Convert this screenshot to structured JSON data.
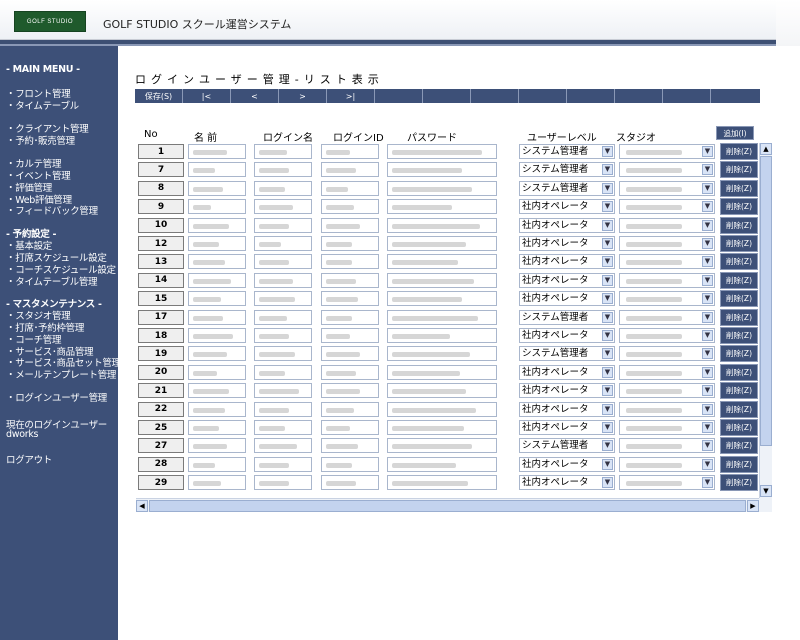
{
  "header": {
    "logo_text": "GOLF STUDIO",
    "title": "GOLF STUDIO スクール運営システム"
  },
  "sidebar": {
    "main_menu": "- MAIN MENU -",
    "items": [
      {
        "label": "・フロント管理"
      },
      {
        "label": "・タイムテーブル"
      },
      {
        "label": "・クライアント管理"
      },
      {
        "label": "・予約･販売管理"
      },
      {
        "label": "・カルテ管理"
      },
      {
        "label": "・イベント管理"
      },
      {
        "label": "・評価管理"
      },
      {
        "label": "・Web評価管理"
      },
      {
        "label": "・フィードバック管理"
      },
      {
        "label": "- 予約設定 -"
      },
      {
        "label": "・基本設定"
      },
      {
        "label": "・打席スケジュール設定"
      },
      {
        "label": "・コーチスケジュール設定"
      },
      {
        "label": "・タイムテーブル管理"
      },
      {
        "label": "- マスタメンテナンス -"
      },
      {
        "label": "・スタジオ管理"
      },
      {
        "label": "・打席･予約枠管理"
      },
      {
        "label": "・コーチ管理"
      },
      {
        "label": "・サービス･商品管理"
      },
      {
        "label": "・サービス･商品セット管理"
      },
      {
        "label": "・メールテンプレート管理"
      },
      {
        "label": "・ログインユーザー管理"
      }
    ],
    "current_user_label": "現在のログインユーザー",
    "current_user": "dworks",
    "logout": "ログアウト"
  },
  "main": {
    "page_title": "ログインユーザー管理-リスト表示",
    "toolbar": {
      "save": "保存(S)",
      "first": "|<",
      "prev": "<",
      "next": ">",
      "last": ">|"
    },
    "columns": {
      "no": "No",
      "name": "名 前",
      "login_name": "ログイン名",
      "login_id": "ログインID",
      "password": "パスワード",
      "user_level": "ユーザーレベル",
      "studio": "スタジオ"
    },
    "add_button": "追加(I)",
    "delete_label": "削除(Z)",
    "rows": [
      {
        "no": "1",
        "level": "システム管理者"
      },
      {
        "no": "7",
        "level": "システム管理者"
      },
      {
        "no": "8",
        "level": "システム管理者"
      },
      {
        "no": "9",
        "level": "社内オペレータ"
      },
      {
        "no": "10",
        "level": "社内オペレータ"
      },
      {
        "no": "12",
        "level": "社内オペレータ"
      },
      {
        "no": "13",
        "level": "社内オペレータ"
      },
      {
        "no": "14",
        "level": "社内オペレータ"
      },
      {
        "no": "15",
        "level": "社内オペレータ"
      },
      {
        "no": "17",
        "level": "システム管理者"
      },
      {
        "no": "18",
        "level": "社内オペレータ"
      },
      {
        "no": "19",
        "level": "システム管理者"
      },
      {
        "no": "20",
        "level": "社内オペレータ"
      },
      {
        "no": "21",
        "level": "社内オペレータ"
      },
      {
        "no": "22",
        "level": "社内オペレータ"
      },
      {
        "no": "25",
        "level": "社内オペレータ"
      },
      {
        "no": "27",
        "level": "システム管理者"
      },
      {
        "no": "28",
        "level": "社内オペレータ"
      },
      {
        "no": "29",
        "level": "社内オペレータ"
      }
    ]
  },
  "colors": {
    "nav_bg": "#3d5078",
    "accent": "#1f5a2c"
  }
}
